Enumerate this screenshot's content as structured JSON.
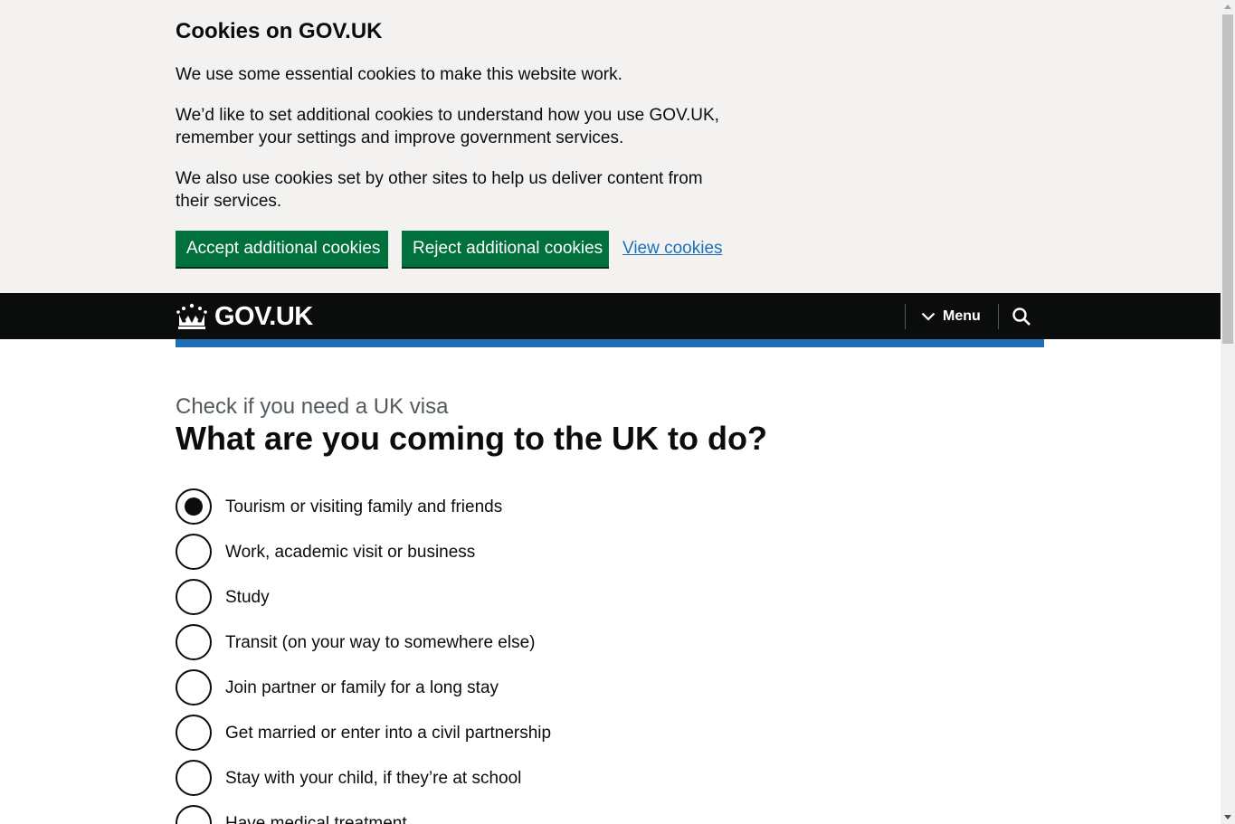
{
  "cookie_banner": {
    "heading": "Cookies on GOV.UK",
    "paragraphs": [
      "We use some essential cookies to make this website work.",
      "We’d like to set additional cookies to understand how you use GOV.UK, remember your settings and improve government services.",
      "We also use cookies set by other sites to help us deliver content from their services."
    ],
    "accept_label": "Accept additional cookies",
    "reject_label": "Reject additional cookies",
    "view_label": "View cookies"
  },
  "header": {
    "logo_text": "GOV.UK",
    "menu_label": "Menu"
  },
  "main": {
    "caption": "Check if you need a UK visa",
    "title": "What are you coming to the UK to do?",
    "options": [
      {
        "label": "Tourism or visiting family and friends",
        "checked": true
      },
      {
        "label": "Work, academic visit or business",
        "checked": false
      },
      {
        "label": "Study",
        "checked": false
      },
      {
        "label": "Transit (on your way to somewhere else)",
        "checked": false
      },
      {
        "label": "Join partner or family for a long stay",
        "checked": false
      },
      {
        "label": "Get married or enter into a civil partnership",
        "checked": false
      },
      {
        "label": "Stay with your child, if they’re at school",
        "checked": false
      },
      {
        "label": "Have medical treatment",
        "checked": false
      }
    ]
  },
  "colors": {
    "button_green": "#00703c",
    "header_black": "#0b0c0c",
    "brand_blue": "#1d70b8",
    "banner_grey": "#f3f2f1"
  }
}
